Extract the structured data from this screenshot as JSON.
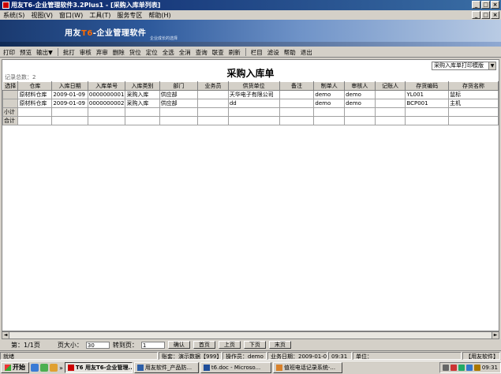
{
  "window": {
    "title": "用友T6-企业管理软件3.2Plus1 - [采购入库单列表]"
  },
  "menu": {
    "items": [
      "系统(S)",
      "视图(V)",
      "窗口(W)",
      "工具(T)",
      "服务专区",
      "帮助(H)"
    ]
  },
  "banner": {
    "brand": "用友",
    "product": "T6",
    "tagline": "-企业管理软件",
    "sub": "企业成长的选择"
  },
  "toolbar": {
    "items": [
      "打印",
      "预览",
      "输出▼",
      "批打",
      "审核",
      "弃审",
      "删除",
      "货位",
      "定位",
      "全选",
      "全消",
      "查询",
      "联查",
      "刷新",
      "栏目",
      "滤设",
      "帮助",
      "退出"
    ]
  },
  "report": {
    "title": "采购入库单",
    "record_count": "记录总数：2",
    "template": "采购入库单打印模版"
  },
  "table": {
    "columns": [
      "选择",
      "仓库",
      "入库日期",
      "入库单号",
      "入库类别",
      "部门",
      "业务员",
      "供货单位",
      "备注",
      "制单人",
      "审核人",
      "记账人",
      "存货编码",
      "存货名称"
    ],
    "rows": [
      [
        "",
        "原材料仓库",
        "2009-01-09",
        "0000000001",
        "采购入库",
        "供应部",
        "",
        "天华电子有限公司",
        "",
        "demo",
        "demo",
        "",
        "YL001",
        "鼠标"
      ],
      [
        "",
        "原材料仓库",
        "2009-01-09",
        "0000000002",
        "采购入库",
        "供应部",
        "",
        "dd",
        "",
        "demo",
        "demo",
        "",
        "BCP001",
        "主机"
      ]
    ],
    "subtotal_label": "小计",
    "total_label": "合计"
  },
  "pager": {
    "page": "第：1/1页",
    "size_label": "页大小：",
    "size_value": "30",
    "goto_label": "转到页：",
    "goto_value": "1",
    "confirm": "确认",
    "first": "首页",
    "prev": "上页",
    "next": "下页",
    "last": "末页"
  },
  "status": {
    "ready": "就绪",
    "account": "账套：演示数据【999】",
    "operator": "操作员：demo",
    "biz_date": "业务日期：2009-01-09",
    "time": "09:31",
    "unit": "单位：",
    "brand": "【用友软件】"
  },
  "taskbar": {
    "start": "开始",
    "tasks": [
      "T6 用友T6-企业管理...",
      "用友软件_产品防...",
      "t6.doc - Microso...",
      "值班电话记录系统-..."
    ],
    "clock": "09:31"
  }
}
